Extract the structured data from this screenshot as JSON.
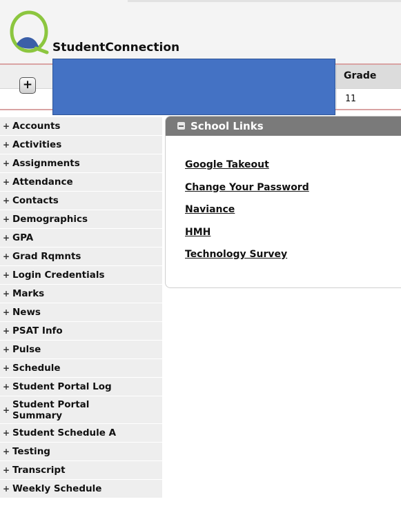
{
  "app": {
    "name": "StudentConnection"
  },
  "student_header": {
    "add_button_label": "+",
    "grade_header": "Grade",
    "grade_value": "11"
  },
  "sidebar": {
    "items": [
      {
        "label": "Accounts"
      },
      {
        "label": "Activities"
      },
      {
        "label": "Assignments"
      },
      {
        "label": "Attendance"
      },
      {
        "label": "Contacts"
      },
      {
        "label": "Demographics"
      },
      {
        "label": "GPA"
      },
      {
        "label": "Grad Rqmnts"
      },
      {
        "label": "Login Credentials"
      },
      {
        "label": "Marks"
      },
      {
        "label": "News"
      },
      {
        "label": "PSAT Info"
      },
      {
        "label": "Pulse"
      },
      {
        "label": "Schedule"
      },
      {
        "label": "Student Portal Log"
      },
      {
        "label": "Student Portal Summary"
      },
      {
        "label": "Student Schedule A"
      },
      {
        "label": "Testing"
      },
      {
        "label": "Transcript"
      },
      {
        "label": "Weekly Schedule"
      }
    ],
    "expand_glyph": "+"
  },
  "school_links": {
    "title": "School Links",
    "links": [
      {
        "label": "Google Takeout"
      },
      {
        "label": "Change Your Password"
      },
      {
        "label": "Naviance"
      },
      {
        "label": "HMH"
      },
      {
        "label": "Technology Survey"
      }
    ]
  },
  "colors": {
    "redaction": "#4472c4",
    "panel_header": "#7a7a7a",
    "logo_green": "#8cc63f",
    "logo_blue": "#3b5fa8"
  }
}
